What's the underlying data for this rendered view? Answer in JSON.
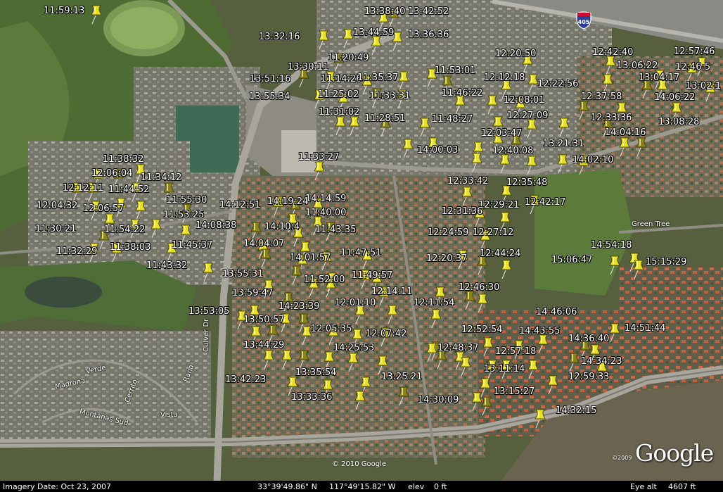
{
  "map": {
    "title": "Google Earth aerial view with GPS track pins",
    "copyright": "© 2010 Google",
    "logo_text": "Google",
    "logo_year": "©2009",
    "highway_shield": "405",
    "pin_color": "#e8e020",
    "street_labels": [
      "Culver Dr",
      "Green Tree",
      "Madrona",
      "Verde",
      "Cerrito",
      "Rana",
      "Montanas Sud",
      "Vista"
    ],
    "status": {
      "imagery_date": "Imagery Date: Oct 23, 2007",
      "latitude": "33°39'49.86\" N",
      "longitude": "117°49'15.82\" W",
      "elev_label": "elev",
      "elev_value": "0 ft",
      "eye_alt_label": "Eye alt",
      "eye_alt_value": "4607 ft"
    }
  },
  "timestamps": [
    "11:59:13",
    "13:38:40",
    "13:42:52",
    "13:32:16",
    "13:44:59",
    "13:36:36",
    "11:20:49",
    "12:20:50",
    "12:42:40",
    "12:57:46",
    "13:30:11",
    "13:51:16",
    "11:14:26",
    "11:35:37",
    "11:53:01",
    "12:12:18",
    "12:22:56",
    "13:06:22",
    "12:46:5",
    "13:04:17",
    "13:02:1",
    "13:55:34",
    "11:25:02",
    "11:33:31",
    "11:46:22",
    "12:08:01",
    "12:37:58",
    "14:06:22",
    "11:31:02",
    "11:28:51",
    "11:48:27",
    "12:27:09",
    "12:33:36",
    "13:08:28",
    "12:03:47",
    "14:04:16",
    "13:21:31",
    "14:00:03",
    "12:40:08",
    "14:02:10",
    "11:33:27",
    "11:38:32",
    "12:06:04",
    "11:34:12",
    "12:12:11",
    "11:44:52",
    "12:33:42",
    "12:35:48",
    "14:14:59",
    "14:19:24",
    "11:55:30",
    "14:12:51",
    "12:04:32",
    "12:06:57",
    "11:40:00",
    "12:42:17",
    "12:29:21",
    "11:53:25",
    "14:08:38",
    "12:31:36",
    "14:10:4",
    "11:43:35",
    "11:30:21",
    "11:54:22",
    "12:27:12",
    "12:24:59",
    "14:04:07",
    "11:45:37",
    "11:32:29",
    "11:38:03",
    "11:47:51",
    "14:01:57",
    "12:44:24",
    "12:20:37",
    "14:54:18",
    "15:06:47",
    "15:15:29",
    "11:43:32",
    "13:55:31",
    "11:49:57",
    "11:52:00",
    "13:59:47",
    "12:46:30",
    "12:14:11",
    "14:23:39",
    "12:01:10",
    "12:11:54",
    "14:46:06",
    "13:53:05",
    "13:50:57",
    "12:05:35",
    "12:07:42",
    "12:52:54",
    "14:43:55",
    "14:51:44",
    "14:36:40",
    "13:44:29",
    "14:25:53",
    "12:48:37",
    "12:57:18",
    "14:34:23",
    "13:35:54",
    "13:11:14",
    "13:42:23",
    "13:25:21",
    "12:59:33",
    "13:33:36",
    "13:15:27",
    "14:30:09",
    "14:32:15"
  ]
}
